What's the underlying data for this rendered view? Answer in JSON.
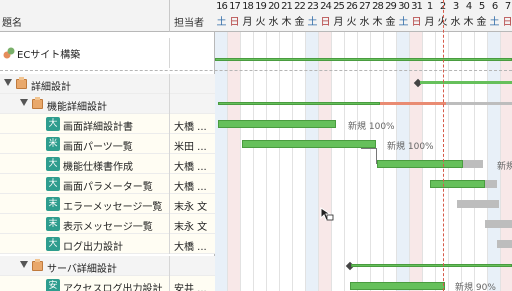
{
  "columns": {
    "name": "題名",
    "assignee": "担当者"
  },
  "days": [
    {
      "num": "16",
      "dow": "土",
      "type": "sat"
    },
    {
      "num": "17",
      "dow": "日",
      "type": "sun"
    },
    {
      "num": "18",
      "dow": "月",
      "type": ""
    },
    {
      "num": "19",
      "dow": "火",
      "type": ""
    },
    {
      "num": "20",
      "dow": "水",
      "type": ""
    },
    {
      "num": "21",
      "dow": "木",
      "type": ""
    },
    {
      "num": "22",
      "dow": "金",
      "type": ""
    },
    {
      "num": "23",
      "dow": "土",
      "type": "sat"
    },
    {
      "num": "24",
      "dow": "日",
      "type": "sun"
    },
    {
      "num": "25",
      "dow": "月",
      "type": ""
    },
    {
      "num": "26",
      "dow": "火",
      "type": ""
    },
    {
      "num": "27",
      "dow": "水",
      "type": ""
    },
    {
      "num": "28",
      "dow": "木",
      "type": ""
    },
    {
      "num": "29",
      "dow": "金",
      "type": ""
    },
    {
      "num": "30",
      "dow": "土",
      "type": "sat"
    },
    {
      "num": "31",
      "dow": "日",
      "type": "sun"
    },
    {
      "num": "1",
      "dow": "月",
      "type": ""
    },
    {
      "num": "2",
      "dow": "火",
      "type": ""
    },
    {
      "num": "3",
      "dow": "水",
      "type": ""
    },
    {
      "num": "4",
      "dow": "木",
      "type": ""
    },
    {
      "num": "5",
      "dow": "金",
      "type": ""
    },
    {
      "num": "6",
      "dow": "土",
      "type": "sat"
    },
    {
      "num": "7",
      "dow": "日",
      "type": "sun"
    }
  ],
  "rows": {
    "project": {
      "label": "ECサイト構築"
    },
    "group1": {
      "label": "詳細設計"
    },
    "group2": {
      "label": "機能詳細設計"
    },
    "t1": {
      "icon": "大",
      "label": "画面詳細設計書",
      "assignee": "大橋 ...",
      "bar_label": "新規 100%"
    },
    "t2": {
      "icon": "米",
      "label": "画面パーツ一覧",
      "assignee": "米田 ...",
      "bar_label": "新規 100%"
    },
    "t3": {
      "icon": "大",
      "label": "機能仕様書作成",
      "assignee": "大橋 ...",
      "bar_label": "新規"
    },
    "t4": {
      "icon": "大",
      "label": "画面パラメーター覧",
      "assignee": "大橋 ..."
    },
    "t5": {
      "icon": "末",
      "label": "エラーメッセージ一覧",
      "assignee": "末永 文"
    },
    "t6": {
      "icon": "末",
      "label": "表示メッセージ一覧",
      "assignee": "末永 文"
    },
    "t7": {
      "icon": "大",
      "label": "ログ出力設計",
      "assignee": "大橋 ..."
    },
    "group3": {
      "label": "サーバ詳細設計"
    },
    "t8": {
      "icon": "安",
      "label": "アクセスログ出力設計",
      "assignee": "安井 ...",
      "bar_label": "新規 90%"
    }
  },
  "progress": {
    "t1": 1.0,
    "t2": 1.0,
    "t8": 0.9
  },
  "colors": {
    "bar_done": "#66c05b",
    "bar_plan": "#bdbdbd",
    "bar_over": "#e98b72",
    "today_line": "#d65a4a"
  }
}
